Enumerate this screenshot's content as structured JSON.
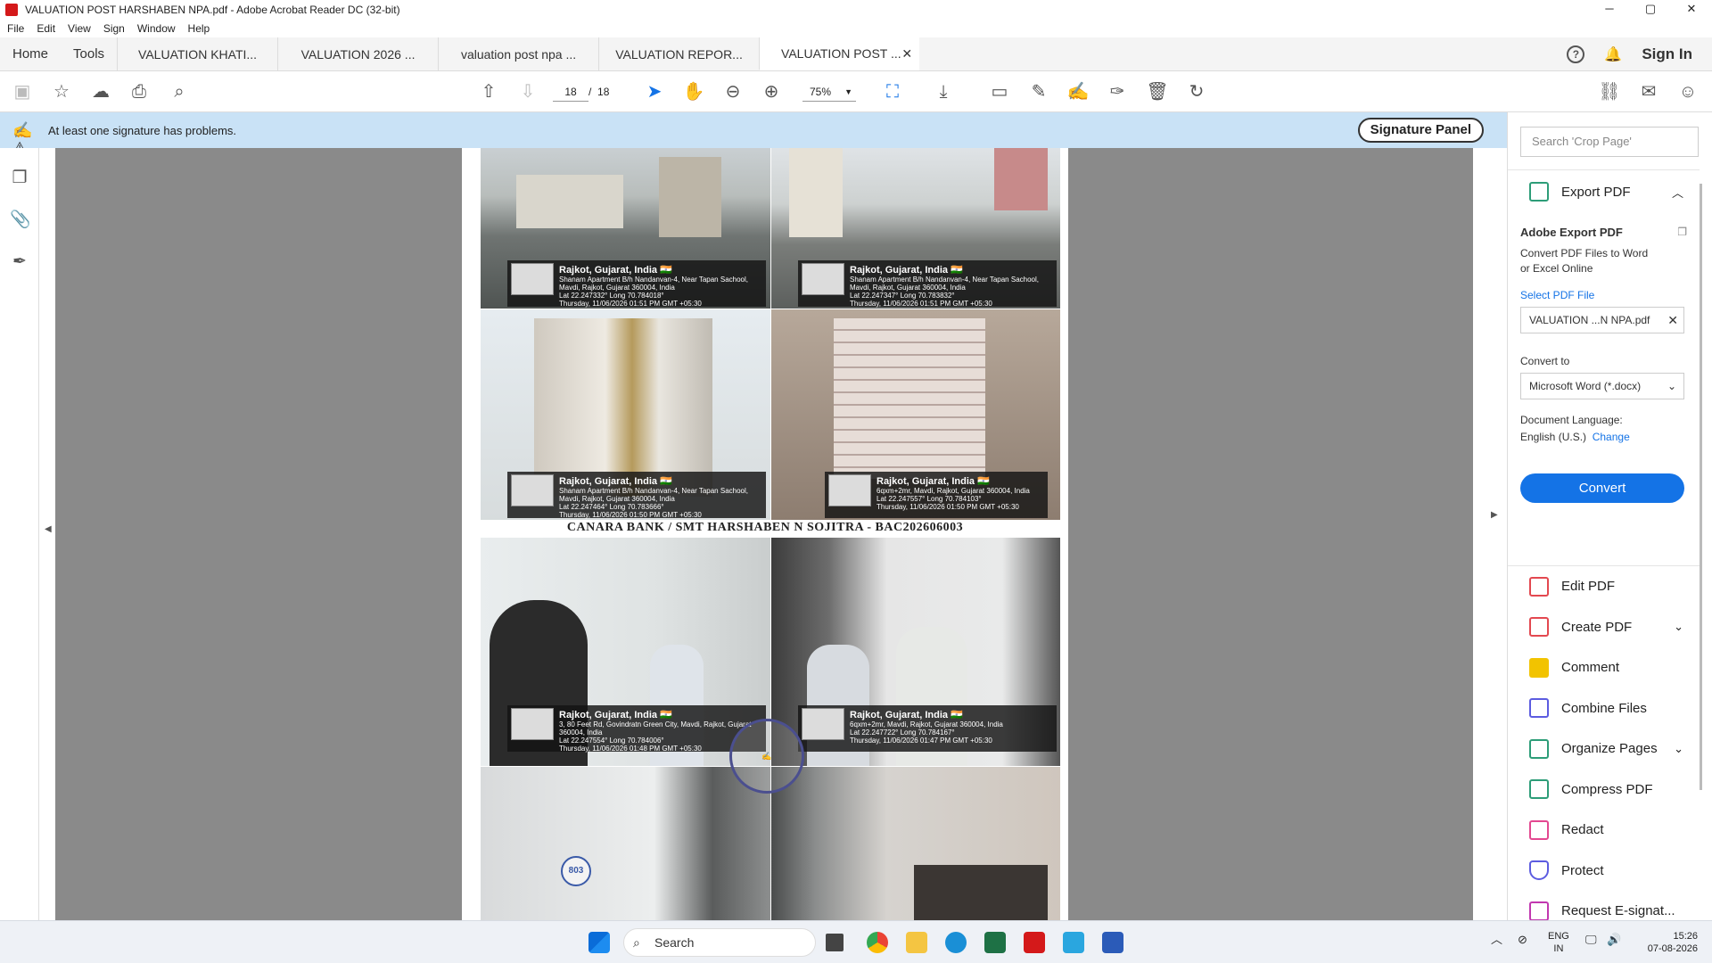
{
  "window": {
    "title": "VALUATION POST HARSHABEN  NPA.pdf - Adobe Acrobat Reader DC (32-bit)",
    "controls": {
      "minimize": "─",
      "maximize": "▢",
      "close": "✕"
    }
  },
  "menu": [
    "File",
    "Edit",
    "View",
    "Sign",
    "Window",
    "Help"
  ],
  "nav": {
    "home": "Home",
    "tools": "Tools",
    "signin": "Sign In"
  },
  "tabs": [
    {
      "label": "VALUATION KHATI..."
    },
    {
      "label": "VALUATION 2026 ..."
    },
    {
      "label": "valuation post npa ..."
    },
    {
      "label": "VALUATION REPOR..."
    },
    {
      "label": "VALUATION POST ..."
    }
  ],
  "toolbar": {
    "current_page": "18",
    "page_sep": "/",
    "total_pages": "18",
    "zoom": "75%"
  },
  "signature_bar": {
    "message": "At least one signature has problems.",
    "button": "Signature Panel"
  },
  "document": {
    "caption": "CANARA BANK / SMT HARSHABEN N SOJITRA - BAC202606003",
    "stamps": [
      {
        "title": "Rajkot, Gujarat, India 🇮🇳",
        "l1": "Shanam Apartment B/h Nandanvan-4, Near Tapan Sachool,",
        "l2": "Mavdi, Rajkot, Gujarat 360004, India",
        "l3": "Lat 22.247332° Long 70.784018°",
        "l4": "Thursday, 11/06/2026 01:51 PM GMT +05:30"
      },
      {
        "title": "Rajkot, Gujarat, India 🇮🇳",
        "l1": "Shanam Apartment B/h Nandanvan-4, Near Tapan Sachool,",
        "l2": "Mavdi, Rajkot, Gujarat 360004, India",
        "l3": "Lat 22.247347° Long 70.783832°",
        "l4": "Thursday, 11/06/2026 01:51 PM GMT +05:30"
      },
      {
        "title": "Rajkot, Gujarat, India 🇮🇳",
        "l1": "Shanam Apartment B/h Nandanvan-4, Near Tapan Sachool,",
        "l2": "Mavdi, Rajkot, Gujarat 360004, India",
        "l3": "Lat 22.247464° Long 70.783666°",
        "l4": "Thursday, 11/06/2026 01:50 PM GMT +05:30"
      },
      {
        "title": "Rajkot, Gujarat, India 🇮🇳",
        "l1": "6qxm+2mr, Mavdi, Rajkot, Gujarat 360004, India",
        "l2": "",
        "l3": "Lat 22.247557° Long 70.784103°",
        "l4": "Thursday, 11/06/2026 01:50 PM GMT +05:30"
      },
      {
        "title": "Rajkot, Gujarat, India 🇮🇳",
        "l1": "3, 80 Feet Rd, Govindratn Green City, Mavdi, Rajkot, Gujarat",
        "l2": "360004, India",
        "l3": "Lat 22.247554° Long 70.784006°",
        "l4": "Thursday, 11/06/2026 01:48 PM GMT +05:30"
      },
      {
        "title": "Rajkot, Gujarat, India 🇮🇳",
        "l1": "6qxm+2mr, Mavdi, Rajkot, Gujarat 360004, India",
        "l2": "",
        "l3": "Lat 22.247722° Long 70.784167°",
        "l4": "Thursday, 11/06/2026 01:47 PM GMT +05:30"
      }
    ],
    "door_number": "803"
  },
  "right_panel": {
    "search_placeholder": "Search 'Crop Page'",
    "export": {
      "header": "Export PDF",
      "title": "Adobe Export PDF",
      "desc1": "Convert PDF Files to Word",
      "desc2": "or Excel Online",
      "select_link": "Select PDF File",
      "file_name": "VALUATION ...N NPA.pdf",
      "convert_to_label": "Convert to",
      "format": "Microsoft Word (*.docx)",
      "lang_label": "Document Language:",
      "lang_value": "English (U.S.)",
      "change": "Change",
      "convert_button": "Convert"
    },
    "tools": [
      {
        "label": "Edit PDF",
        "color": "#e34850"
      },
      {
        "label": "Create PDF",
        "color": "#e34850"
      },
      {
        "label": "Comment",
        "color": "#f2c300"
      },
      {
        "label": "Combine Files",
        "color": "#5c5ce0"
      },
      {
        "label": "Organize Pages",
        "color": "#2d9d78"
      },
      {
        "label": "Compress PDF",
        "color": "#2d9d78"
      },
      {
        "label": "Redact",
        "color": "#e34890"
      },
      {
        "label": "Protect",
        "color": "#5c5ce0"
      },
      {
        "label": "Request E-signat...",
        "color": "#c138b0"
      }
    ]
  },
  "taskbar": {
    "search": "Search",
    "lang1": "ENG",
    "lang2": "IN",
    "time": "15:26",
    "date": "07-08-2026"
  }
}
